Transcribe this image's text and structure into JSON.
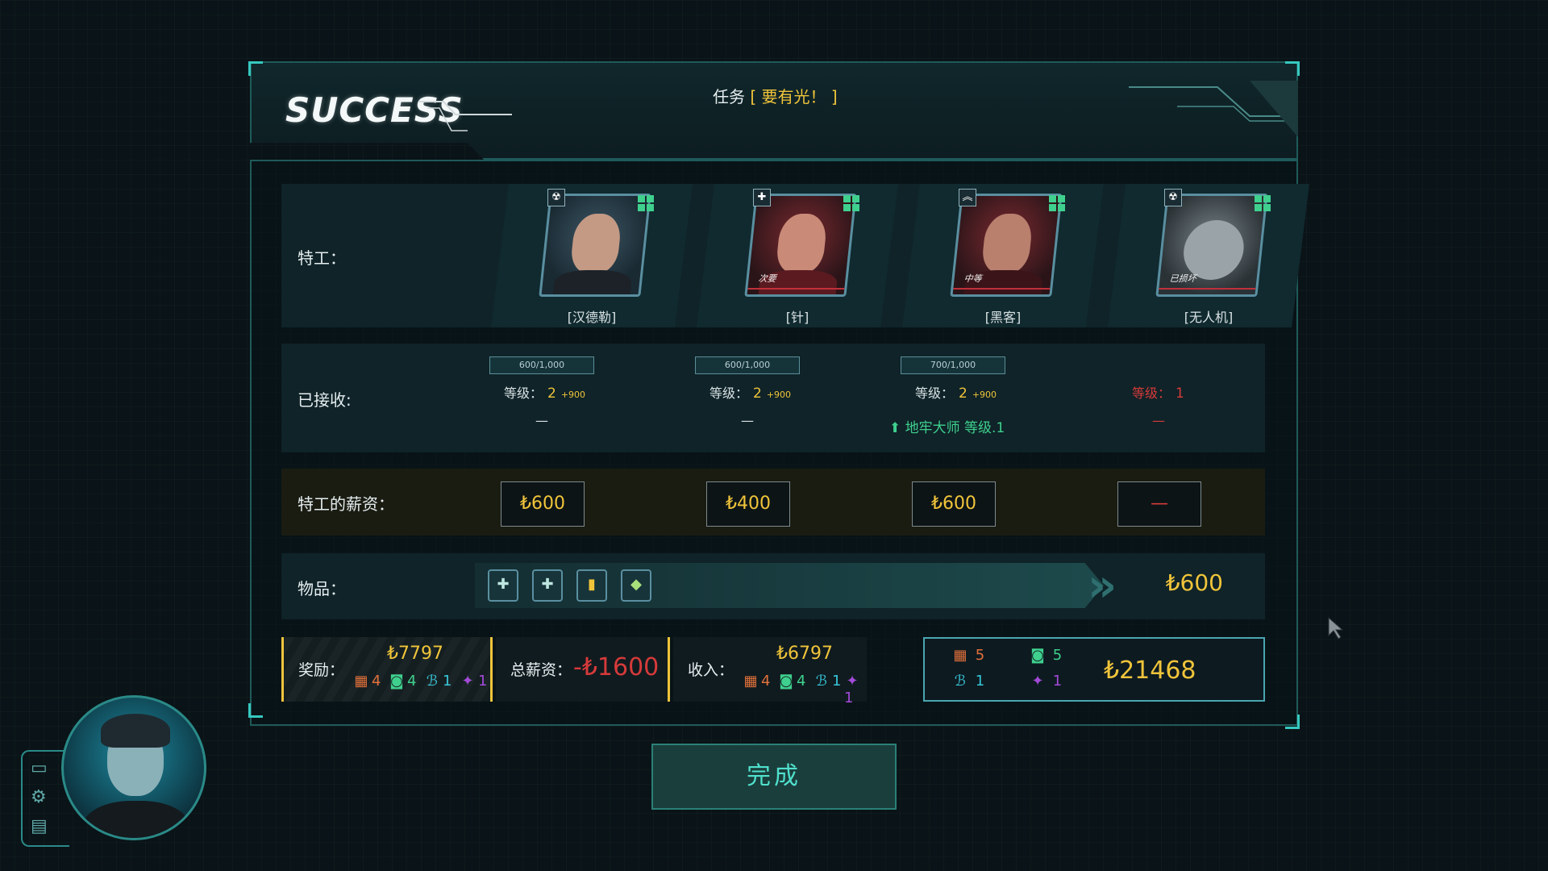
{
  "header": {
    "title": "SUCCESS",
    "mission_prefix": "任务",
    "mission_name": "[ 要有光！ ]"
  },
  "labels": {
    "agents": "特工：",
    "received": "已接收:",
    "salary": "特工的薪资：",
    "items": "物品："
  },
  "agents": [
    {
      "name": "[汉德勒]",
      "class_icon": "radiation-icon",
      "tag": "",
      "xp": "600/1,000",
      "level_label": "等级：",
      "level": "2",
      "xp_gain": "+900",
      "unlock": "—",
      "salary": "₺600"
    },
    {
      "name": "[针]",
      "class_icon": "plus-icon",
      "tag": "次要",
      "xp": "600/1,000",
      "level_label": "等级：",
      "level": "2",
      "xp_gain": "+900",
      "unlock": "—",
      "salary": "₺400"
    },
    {
      "name": "[黑客]",
      "class_icon": "chevron-up-icon",
      "tag": "中等",
      "xp": "700/1,000",
      "level_label": "等级：",
      "level": "2",
      "xp_gain": "+900",
      "unlock": "地牢大师 等级.1",
      "salary": "₺600"
    },
    {
      "name": "[无人机]",
      "class_icon": "radiation-icon",
      "tag": "已损坏",
      "xp": "",
      "level_label": "等级：",
      "level": "1",
      "xp_gain": "",
      "unlock": "—",
      "salary": "—"
    }
  ],
  "items": {
    "icons": [
      "medkit-icon",
      "medkit-icon",
      "battery-icon",
      "grenade-icon"
    ],
    "total": "₺600"
  },
  "summary": {
    "reward_label": "奖励：",
    "reward_money": "₺7797",
    "reward_res": [
      "4",
      "4",
      "1",
      "1"
    ],
    "total_salary_label": "总薪资：",
    "total_salary": "-₺1600",
    "income_label": "收入：",
    "income_money": "₺6797",
    "income_res": [
      "4",
      "4",
      "1",
      "1"
    ],
    "stock_res": [
      "5",
      "5",
      "1",
      "1"
    ],
    "balance": "₺21468"
  },
  "finish_button": "完成",
  "colors": {
    "accent": "#36c8bf",
    "money": "#f0c43a",
    "negative": "#d63a3a",
    "unlock": "#3fd08e"
  }
}
